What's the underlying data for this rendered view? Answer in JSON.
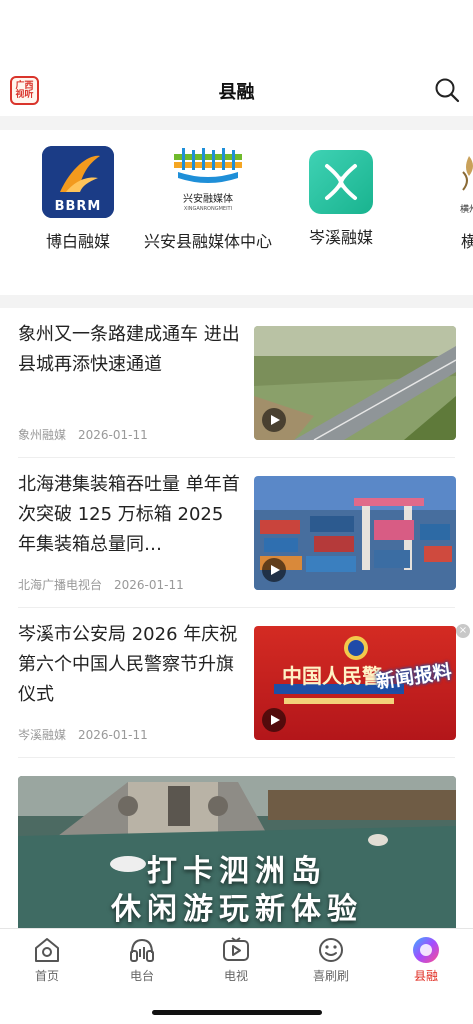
{
  "header": {
    "logo_text": "广西视听",
    "title": "县融"
  },
  "media_outlets": [
    {
      "name": "博白融媒",
      "logo_text": "BBRM"
    },
    {
      "name": "兴安县融媒体中心",
      "logo_text": "兴安融媒体",
      "logo_subtext": "XINGANRONGMEITI"
    },
    {
      "name": "岑溪融媒",
      "logo_text": ""
    },
    {
      "name": "横",
      "logo_text": "横州"
    }
  ],
  "news": [
    {
      "title": "象州又一条路建成通车 进出县城再添快速通道",
      "source": "象州融媒",
      "date": "2026-01-11"
    },
    {
      "title": "北海港集装箱吞吐量 单年首次突破 125 万标箱 2025 年集装箱总量同…",
      "source": "北海广播电视台",
      "date": "2026-01-11"
    },
    {
      "title": "岑溪市公安局 2026 年庆祝第六个中国人民警察节升旗仪式",
      "source": "岑溪融媒",
      "date": "2026-01-11",
      "thumb_text": "中国人民警",
      "thumb_badge": "新闻报料"
    }
  ],
  "banner": {
    "line1": "打卡泗洲岛",
    "line2": "休闲游玩新体验"
  },
  "tabbar": [
    {
      "label": "首页",
      "icon": "home-icon"
    },
    {
      "label": "电台",
      "icon": "headphones-icon"
    },
    {
      "label": "电视",
      "icon": "tv-play-icon"
    },
    {
      "label": "喜刷刷",
      "icon": "smile-icon"
    },
    {
      "label": "县融",
      "icon": "county-media-icon",
      "active": true
    }
  ],
  "colors": {
    "accent": "#e02b20",
    "meta": "#999999",
    "background_band": "#f3f3f3"
  }
}
